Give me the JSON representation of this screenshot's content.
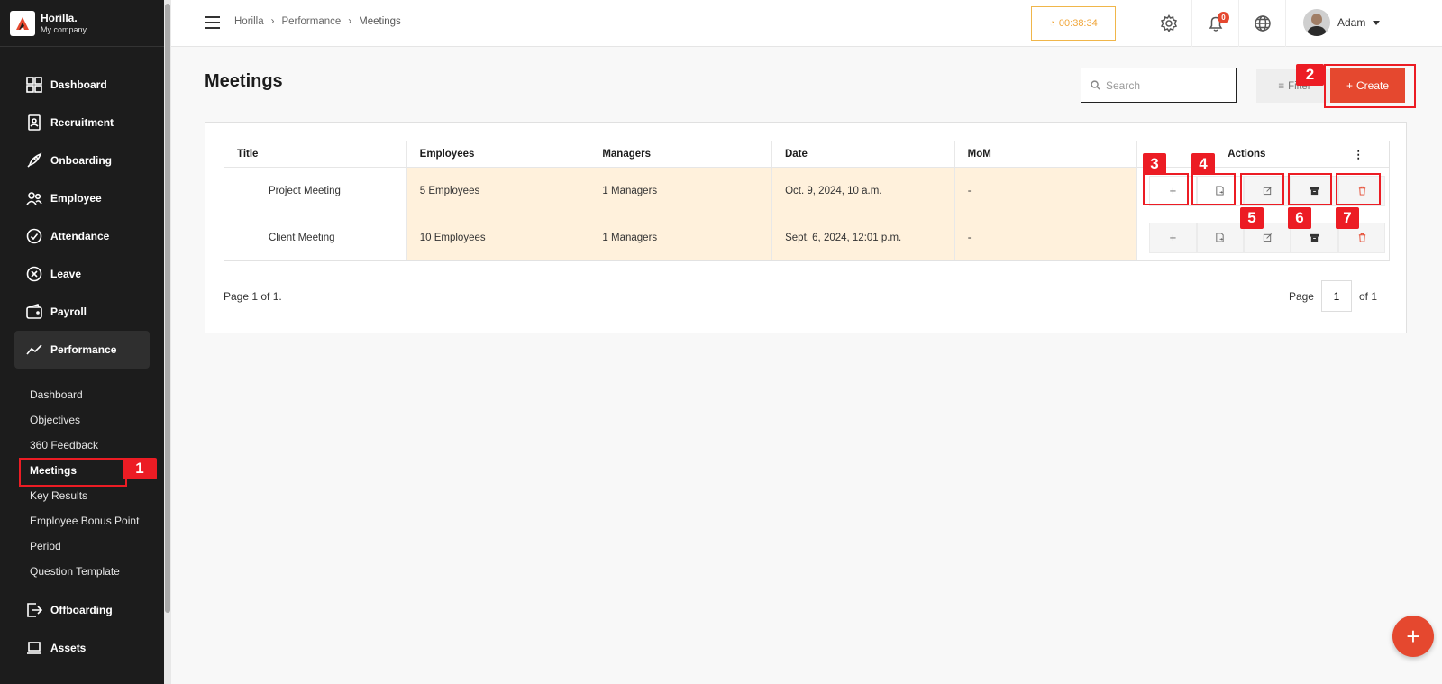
{
  "brand": {
    "name": "Horilla.",
    "company": "My company"
  },
  "sidebar": {
    "items": [
      {
        "label": "Dashboard",
        "icon": "dashboard-icon"
      },
      {
        "label": "Recruitment",
        "icon": "recruitment-icon"
      },
      {
        "label": "Onboarding",
        "icon": "rocket-icon"
      },
      {
        "label": "Employee",
        "icon": "people-icon"
      },
      {
        "label": "Attendance",
        "icon": "check-circle-icon"
      },
      {
        "label": "Leave",
        "icon": "x-circle-icon"
      },
      {
        "label": "Payroll",
        "icon": "wallet-icon"
      },
      {
        "label": "Performance",
        "icon": "trend-icon"
      },
      {
        "label": "Offboarding",
        "icon": "exit-icon"
      },
      {
        "label": "Assets",
        "icon": "laptop-icon"
      }
    ],
    "performance_sub": [
      "Dashboard",
      "Objectives",
      "360 Feedback",
      "Meetings",
      "Key Results",
      "Employee Bonus Point",
      "Period",
      "Question Template"
    ]
  },
  "header": {
    "breadcrumb": [
      "Horilla",
      "Performance",
      "Meetings"
    ],
    "timer": "00:38:34",
    "notification_count": "0",
    "user_name": "Adam"
  },
  "main": {
    "title": "Meetings",
    "search_placeholder": "Search",
    "filter_label": "Filter",
    "create_label": "Create",
    "columns": [
      "Title",
      "Employees",
      "Managers",
      "Date",
      "MoM",
      "Actions"
    ],
    "rows": [
      {
        "title": "Project Meeting",
        "employees": "5 Employees",
        "managers": "1 Managers",
        "date": "Oct. 9, 2024, 10 a.m.",
        "mom": "-"
      },
      {
        "title": "Client Meeting",
        "employees": "10 Employees",
        "managers": "1 Managers",
        "date": "Sept. 6, 2024, 12:01 p.m.",
        "mom": "-"
      }
    ],
    "page_info": "Page 1 of 1.",
    "pager": {
      "page_label": "Page",
      "current": "1",
      "of_label": "of 1"
    }
  },
  "annotations": [
    "1",
    "2",
    "3",
    "4",
    "5",
    "6",
    "7"
  ],
  "colors": {
    "accent": "#e5482f",
    "highlight": "#fff1dc",
    "annotation": "#ec1c24",
    "timer": "#f0a63a"
  }
}
